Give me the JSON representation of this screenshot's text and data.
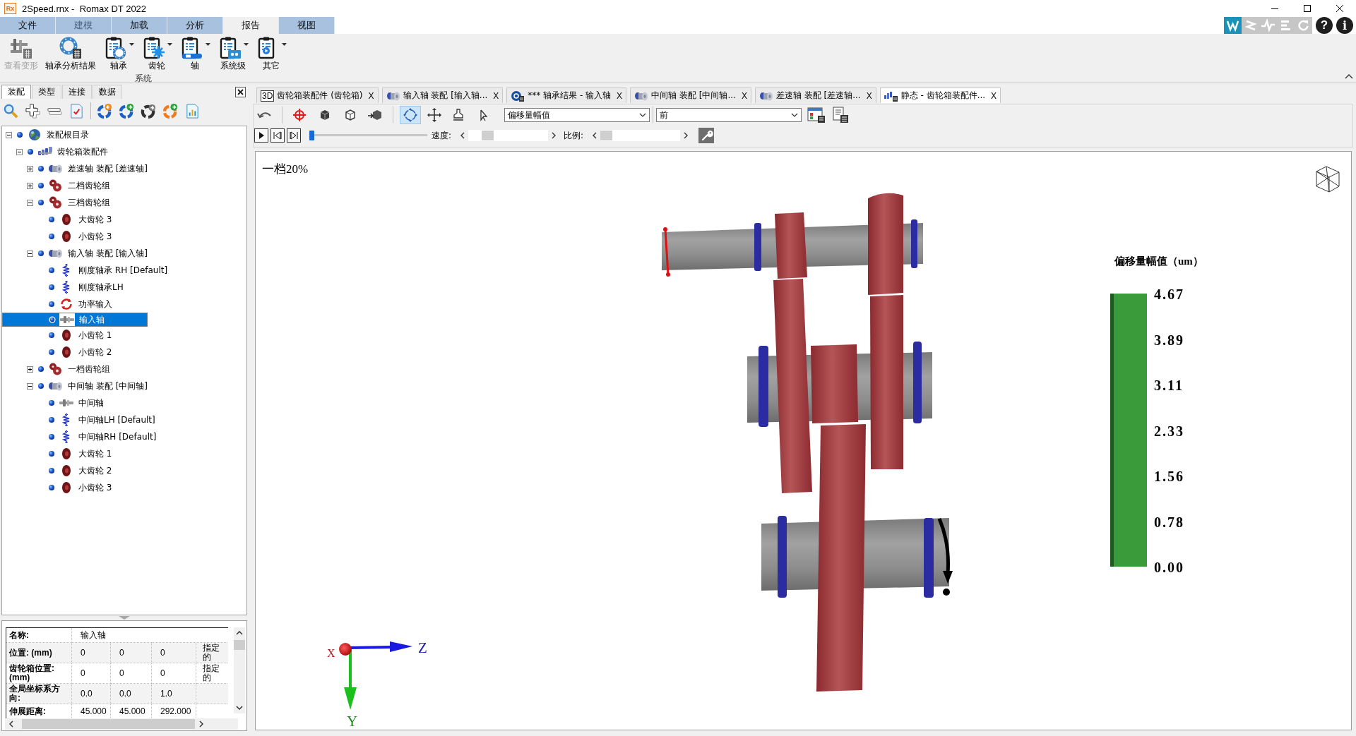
{
  "window": {
    "icon_label": "Rx",
    "title": "2Speed.rnx -  Romax DT 2022"
  },
  "menu_tabs": [
    {
      "label": "文件",
      "selected": false,
      "disabled": false
    },
    {
      "label": "建模",
      "selected": false,
      "disabled": true
    },
    {
      "label": "加载",
      "selected": false,
      "disabled": false
    },
    {
      "label": "分析",
      "selected": false,
      "disabled": false
    },
    {
      "label": "报告",
      "selected": true,
      "disabled": false
    },
    {
      "label": "视图",
      "selected": false,
      "disabled": false
    }
  ],
  "quick_tools": [
    {
      "kind": "logo",
      "on": true
    },
    {
      "kind": "connect",
      "on": false
    },
    {
      "kind": "wave",
      "on": false
    },
    {
      "kind": "bars",
      "on": false
    },
    {
      "kind": "refresh",
      "on": false
    }
  ],
  "help_buttons": [
    {
      "kind": "help",
      "label": "?"
    },
    {
      "kind": "info",
      "label": "i"
    }
  ],
  "ribbon": {
    "buttons": [
      {
        "label": "查看变形",
        "kind": "deform",
        "disabled": true,
        "dropdown": false
      },
      {
        "label": "轴承分析结果",
        "kind": "bearing_results",
        "disabled": false,
        "dropdown": false
      },
      {
        "label": "轴承",
        "kind": "bearing_report",
        "disabled": false,
        "dropdown": true
      },
      {
        "label": "齿轮",
        "kind": "gear_report",
        "disabled": false,
        "dropdown": true
      },
      {
        "label": "轴",
        "kind": "shaft_report",
        "disabled": false,
        "dropdown": true
      },
      {
        "label": "系统级",
        "kind": "system_report",
        "disabled": false,
        "dropdown": true
      },
      {
        "label": "其它",
        "kind": "other_report",
        "disabled": false,
        "dropdown": true
      }
    ],
    "group_label": "系统"
  },
  "left_panel": {
    "tabs": [
      {
        "label": "装配",
        "selected": true
      },
      {
        "label": "类型",
        "selected": false
      },
      {
        "label": "连接",
        "selected": false
      },
      {
        "label": "数据",
        "selected": false
      }
    ]
  },
  "tree": [
    {
      "label": "装配根目录",
      "kind": "root",
      "expanded": true,
      "selected": false,
      "children": [
        {
          "label": "齿轮箱装配件",
          "kind": "assembly",
          "expanded": true,
          "selected": false,
          "children": [
            {
              "label": "差速轴 装配 [差速轴]",
              "kind": "shaft_assembly",
              "expanded": false,
              "selected": false
            },
            {
              "label": "二档齿轮组",
              "kind": "gear_set",
              "expanded": false,
              "selected": false
            },
            {
              "label": "三档齿轮组",
              "kind": "gear_set",
              "expanded": true,
              "selected": false,
              "children": [
                {
                  "label": "大齿轮 3",
                  "kind": "gear",
                  "selected": false
                },
                {
                  "label": "小齿轮 3",
                  "kind": "gear",
                  "selected": false
                }
              ]
            },
            {
              "label": "输入轴 装配 [输入轴]",
              "kind": "shaft_assembly",
              "expanded": true,
              "selected": false,
              "children": [
                {
                  "label": "刚度轴承 RH [Default]",
                  "kind": "spring",
                  "selected": false
                },
                {
                  "label": "刚度轴承LH",
                  "kind": "spring",
                  "selected": false
                },
                {
                  "label": "功率输入",
                  "kind": "power",
                  "selected": false
                },
                {
                  "label": "输入轴",
                  "kind": "shaft",
                  "selected": true
                },
                {
                  "label": "小齿轮 1",
                  "kind": "gear",
                  "selected": false
                },
                {
                  "label": "小齿轮 2",
                  "kind": "gear",
                  "selected": false
                }
              ]
            },
            {
              "label": "一档齿轮组",
              "kind": "gear_set",
              "expanded": false,
              "selected": false
            },
            {
              "label": "中间轴 装配 [中间轴]",
              "kind": "shaft_assembly",
              "expanded": true,
              "selected": false,
              "children": [
                {
                  "label": "中间轴",
                  "kind": "shaft",
                  "selected": false
                },
                {
                  "label": "中间轴LH [Default]",
                  "kind": "spring",
                  "selected": false
                },
                {
                  "label": "中间轴RH [Default]",
                  "kind": "spring",
                  "selected": false
                },
                {
                  "label": "大齿轮 1",
                  "kind": "gear",
                  "selected": false
                },
                {
                  "label": "大齿轮 2",
                  "kind": "gear",
                  "selected": false
                },
                {
                  "label": "小齿轮 3",
                  "kind": "gear",
                  "selected": false
                }
              ]
            }
          ]
        }
      ]
    }
  ],
  "properties": {
    "rows": [
      {
        "cells": [
          "名称:",
          {
            "text": "输入轴",
            "colspan": 4
          }
        ]
      },
      {
        "cells": [
          "位置: (mm)",
          "0",
          "0",
          "0",
          "指定的"
        ]
      },
      {
        "cells": [
          "齿轮箱位置: (mm)",
          "0",
          "0",
          "0",
          "指定的"
        ]
      },
      {
        "cells": [
          "全局坐标系方向:",
          "0.0",
          "0.0",
          "1.0"
        ]
      },
      {
        "cells": [
          "伸展距离:",
          "45.000",
          "45.000",
          "292.000"
        ]
      }
    ]
  },
  "document_tabs": [
    {
      "kind": "model3d",
      "badge": "3D",
      "label": "齿轮箱装配件 (齿轮箱)",
      "close": "X",
      "selected": false
    },
    {
      "kind": "assembly",
      "label": "输入轴 装配 [输入轴...",
      "close": "X",
      "selected": false
    },
    {
      "kind": "bearing_result",
      "label": "*** 轴承结果 - 输入轴",
      "close": "X",
      "selected": false
    },
    {
      "kind": "assembly",
      "label": "中间轴 装配 [中间轴...",
      "close": "X",
      "selected": false
    },
    {
      "kind": "assembly",
      "label": "差速轴 装配 [差速轴...",
      "close": "X",
      "selected": false
    },
    {
      "kind": "static",
      "label": "静态 - 齿轮箱装配件...",
      "close": "X",
      "selected": true
    }
  ],
  "view_tool_groups": [
    {
      "tools": [
        {
          "kind": "undo",
          "selected": false
        }
      ]
    },
    {
      "tools": [
        {
          "kind": "target",
          "selected": false
        },
        {
          "kind": "solid",
          "selected": false
        },
        {
          "kind": "wire",
          "selected": false
        },
        {
          "kind": "shaded",
          "selected": false
        }
      ]
    },
    {
      "tools": [
        {
          "kind": "rotate",
          "selected": true
        },
        {
          "kind": "pan",
          "selected": false
        },
        {
          "kind": "zoom",
          "selected": false
        },
        {
          "kind": "pointer",
          "selected": false
        }
      ]
    }
  ],
  "view_selects": [
    {
      "value": "偏移量幅值"
    },
    {
      "value": "前"
    }
  ],
  "playback": {
    "progress": {
      "level": 0
    },
    "speed": {
      "label": "速度:",
      "level": 0.2
    },
    "scale": {
      "label": "比例:",
      "level": 0
    }
  },
  "viewport": {
    "caption": "一档20%",
    "legend": {
      "title": "偏移量幅值（um）",
      "labels": [
        "4.67",
        "3.89",
        "3.11",
        "2.33",
        "1.56",
        "0.78",
        "0.00"
      ]
    },
    "axes": {
      "x": "X",
      "y": "Y",
      "z": "Z"
    }
  }
}
